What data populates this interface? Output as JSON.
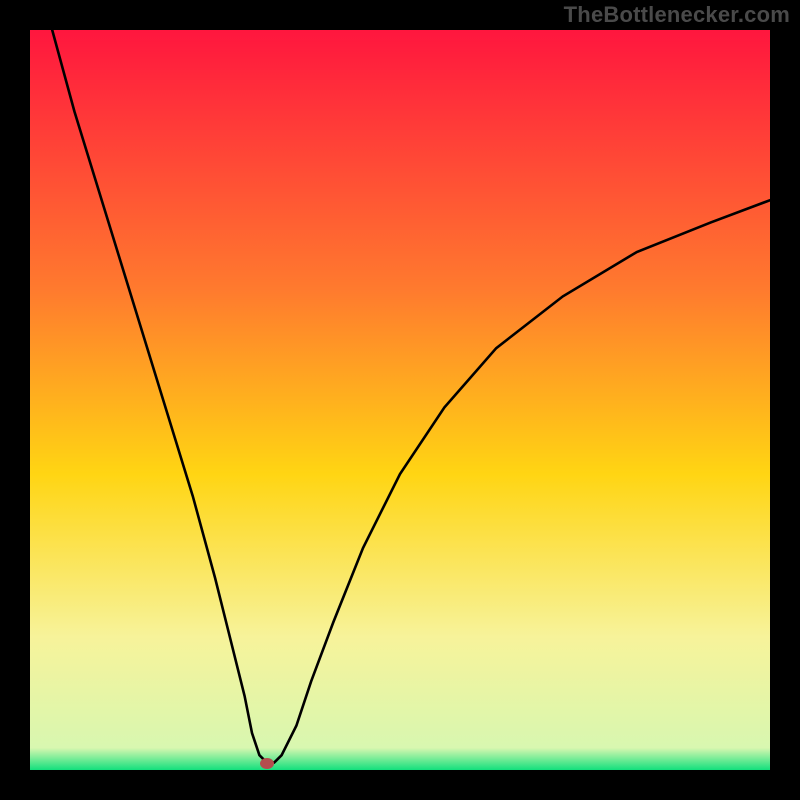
{
  "attribution": "TheBottlenecker.com",
  "colors": {
    "frame": "#000000",
    "grad_top": "#ff163e",
    "grad_mid1": "#ff7a2e",
    "grad_mid2": "#ffd513",
    "grad_mid3": "#f7f39a",
    "grad_bottom": "#13e07d",
    "curve": "#000000",
    "dot": "#b44e4e"
  },
  "chart_data": {
    "type": "line",
    "title": "",
    "xlabel": "",
    "ylabel": "",
    "xlim": [
      0,
      100
    ],
    "ylim": [
      0,
      100
    ],
    "gradient_stops": [
      {
        "offset": 0.0,
        "color": "#ff163e"
      },
      {
        "offset": 0.35,
        "color": "#ff7a2e"
      },
      {
        "offset": 0.6,
        "color": "#ffd513"
      },
      {
        "offset": 0.82,
        "color": "#f7f39a"
      },
      {
        "offset": 0.97,
        "color": "#d8f7b0"
      },
      {
        "offset": 1.0,
        "color": "#13e07d"
      }
    ],
    "series": [
      {
        "name": "bottleneck-curve",
        "x": [
          3,
          6,
          10,
          14,
          18,
          22,
          25,
          27,
          29,
          30,
          31,
          32,
          33,
          34,
          36,
          38,
          41,
          45,
          50,
          56,
          63,
          72,
          82,
          92,
          100
        ],
        "y": [
          100,
          89,
          76,
          63,
          50,
          37,
          26,
          18,
          10,
          5,
          2,
          1,
          1,
          2,
          6,
          12,
          20,
          30,
          40,
          49,
          57,
          64,
          70,
          74,
          77
        ]
      }
    ],
    "min_point": {
      "x": 32,
      "y": 1
    },
    "annotations": []
  }
}
